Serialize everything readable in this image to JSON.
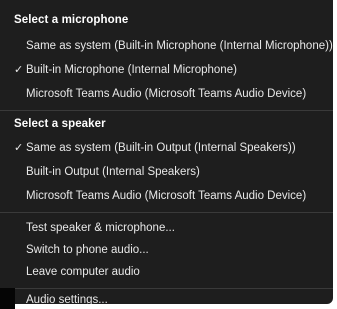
{
  "microphone": {
    "header": "Select a microphone",
    "items": [
      {
        "label": "Same as system (Built-in Microphone (Internal Microphone))",
        "selected": false
      },
      {
        "label": "Built-in Microphone (Internal Microphone)",
        "selected": true
      },
      {
        "label": "Microsoft Teams Audio (Microsoft Teams Audio Device)",
        "selected": false
      }
    ]
  },
  "speaker": {
    "header": "Select a speaker",
    "items": [
      {
        "label": "Same as system (Built-in Output (Internal Speakers))",
        "selected": true
      },
      {
        "label": "Built-in Output (Internal Speakers)",
        "selected": false
      },
      {
        "label": "Microsoft Teams Audio (Microsoft Teams Audio Device)",
        "selected": false
      }
    ]
  },
  "actions": [
    {
      "label": "Test speaker & microphone..."
    },
    {
      "label": "Switch to phone audio..."
    },
    {
      "label": "Leave computer audio"
    }
  ],
  "settings": {
    "label": "Audio settings..."
  },
  "check_glyph": "✓"
}
